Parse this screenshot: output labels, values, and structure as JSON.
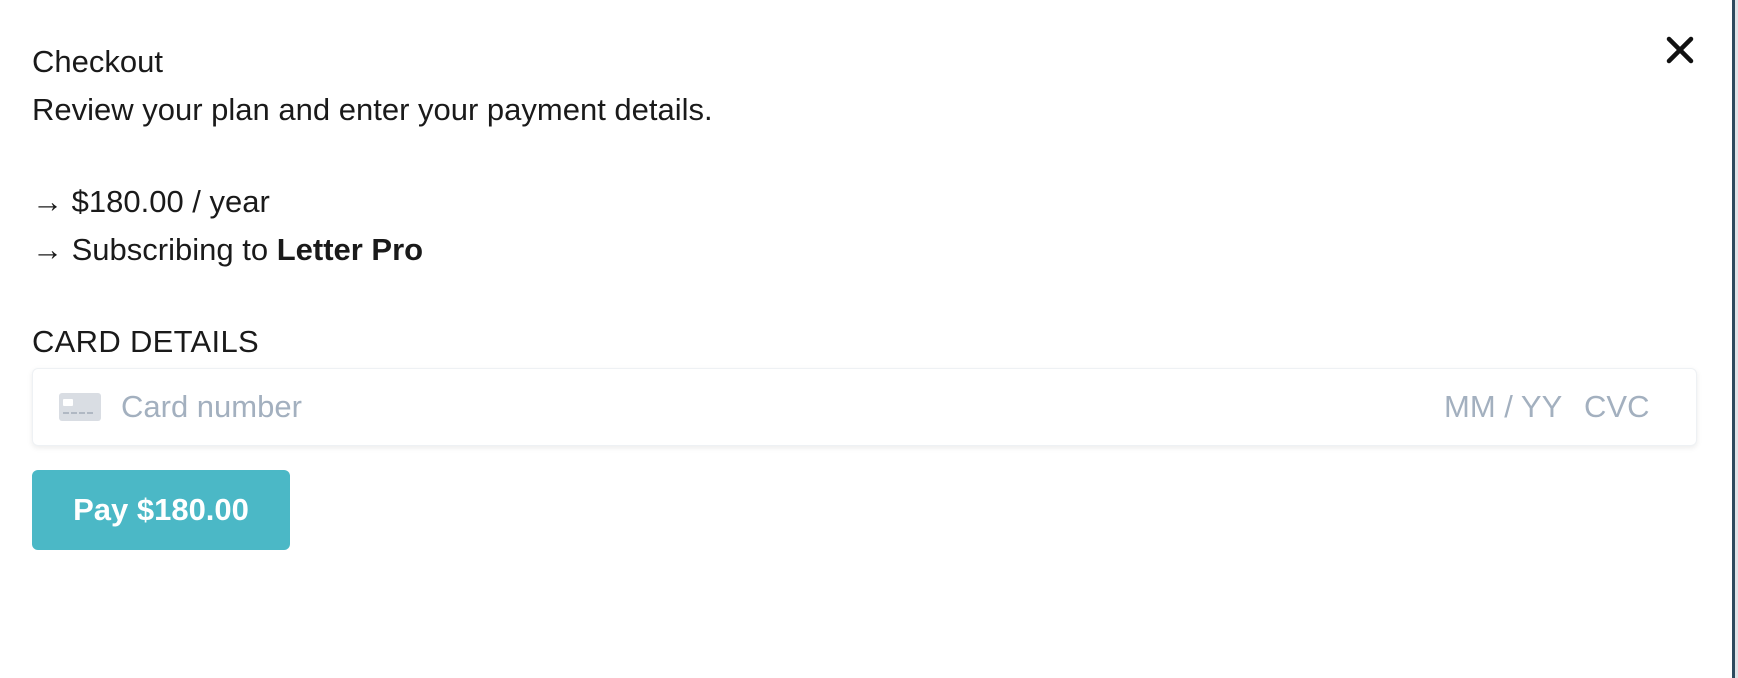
{
  "checkout": {
    "title": "Checkout",
    "subtitle": "Review your plan and enter your payment details.",
    "arrow": "→",
    "price_line": "$180.00 / year",
    "subscribing_prefix": "Subscribing to ",
    "plan_name": "Letter Pro",
    "card_section_label": "CARD DETAILS",
    "card_number_placeholder": "Card number",
    "expiry_placeholder": "MM / YY",
    "cvc_placeholder": "CVC",
    "pay_button_label": "Pay $180.00"
  },
  "icons": {
    "close": "close-icon",
    "card": "credit-card-icon"
  },
  "colors": {
    "pay_button": "#4bb8c6",
    "placeholder": "#a3b0bf",
    "text": "#1a1a1a"
  }
}
